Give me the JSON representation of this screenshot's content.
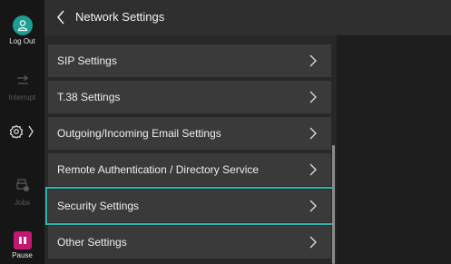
{
  "rail": {
    "logout_label": "Log Out",
    "interrupt_label": "Interrupt",
    "jobs_label": "Jobs",
    "pause_label": "Pause"
  },
  "header": {
    "title": "Network Settings"
  },
  "list": {
    "items": [
      {
        "label": "SIP Settings"
      },
      {
        "label": "T.38 Settings"
      },
      {
        "label": "Outgoing/Incoming Email Settings"
      },
      {
        "label": "Remote Authentication / Directory Service"
      },
      {
        "label": "Security Settings",
        "selected": true
      },
      {
        "label": "Other Settings"
      }
    ]
  },
  "colors": {
    "accent_teal": "#2ab7b0",
    "logout_teal": "#1f9d94",
    "pause_magenta": "#c2186f"
  }
}
